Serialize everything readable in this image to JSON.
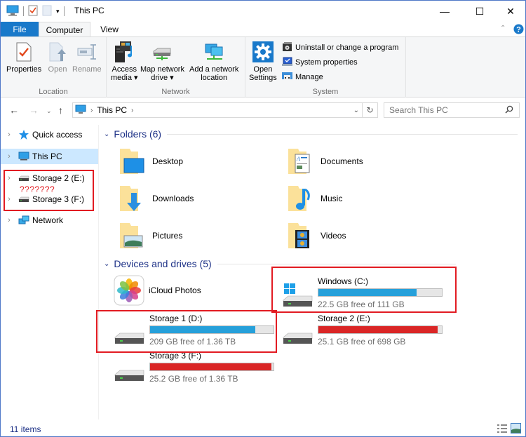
{
  "window": {
    "title": "This PC",
    "controls": {
      "minimize": "—",
      "maximize": "☐",
      "close": "✕"
    }
  },
  "ribbon": {
    "tabs": [
      {
        "label": "File"
      },
      {
        "label": "Computer"
      },
      {
        "label": "View"
      }
    ],
    "groups": {
      "location": {
        "label": "Location",
        "buttons": [
          {
            "label": "Properties",
            "icon": "properties-icon",
            "enabled": true
          },
          {
            "label": "Open",
            "icon": "open-icon",
            "enabled": false
          },
          {
            "label": "Rename",
            "icon": "rename-icon",
            "enabled": false
          }
        ]
      },
      "network": {
        "label": "Network",
        "buttons": [
          {
            "label_line1": "Access",
            "label_line2": "media ▾",
            "icon": "access-media-icon"
          },
          {
            "label_line1": "Map network",
            "label_line2": "drive ▾",
            "icon": "map-network-drive-icon"
          },
          {
            "label_line1": "Add a network",
            "label_line2": "location",
            "icon": "add-network-location-icon"
          }
        ]
      },
      "system": {
        "label": "System",
        "open_settings_line1": "Open",
        "open_settings_line2": "Settings",
        "small_buttons": [
          {
            "label": "Uninstall or change a program",
            "icon": "uninstall-program-icon"
          },
          {
            "label": "System properties",
            "icon": "system-properties-icon"
          },
          {
            "label": "Manage",
            "icon": "manage-icon"
          }
        ]
      }
    }
  },
  "address": {
    "path": [
      "This PC"
    ],
    "search_placeholder": "Search This PC"
  },
  "navpane": {
    "items": [
      {
        "label": "Quick access",
        "icon": "quick-access-star-icon",
        "selected": false
      },
      {
        "label": "This PC",
        "icon": "this-pc-icon",
        "selected": true
      },
      {
        "label": "Storage 2 (E:)",
        "icon": "drive-icon",
        "selected": false
      },
      {
        "label": "Storage 3 (F:)",
        "icon": "drive-icon",
        "selected": false
      },
      {
        "label": "Network",
        "icon": "network-icon",
        "selected": false
      }
    ],
    "annotation": "???????"
  },
  "content": {
    "folders_header": "Folders (6)",
    "folders": [
      {
        "name": "Desktop",
        "icon": "desktop-folder-icon"
      },
      {
        "name": "Documents",
        "icon": "documents-folder-icon"
      },
      {
        "name": "Downloads",
        "icon": "downloads-folder-icon"
      },
      {
        "name": "Music",
        "icon": "music-folder-icon"
      },
      {
        "name": "Pictures",
        "icon": "pictures-folder-icon"
      },
      {
        "name": "Videos",
        "icon": "videos-folder-icon"
      }
    ],
    "devices_header": "Devices and drives (5)",
    "icloud": {
      "name": "iCloud Photos"
    },
    "drives": [
      {
        "name": "Windows (C:)",
        "free": "22.5 GB free of 111 GB",
        "used_fraction": 0.797,
        "status": "normal"
      },
      {
        "name": "Storage 1 (D:)",
        "free": "209 GB free of 1.36 TB",
        "used_fraction": 0.85,
        "status": "normal"
      },
      {
        "name": "Storage 2 (E:)",
        "free": "25.1 GB free of 698 GB",
        "used_fraction": 0.964,
        "status": "critical"
      },
      {
        "name": "Storage 3 (F:)",
        "free": "25.2 GB free of 1.36 TB",
        "used_fraction": 0.982,
        "status": "critical"
      }
    ],
    "colors": {
      "normal": "#26a0da",
      "critical": "#da2626",
      "track": "#e6e6e6"
    }
  },
  "status": {
    "item_count": "11 items"
  }
}
